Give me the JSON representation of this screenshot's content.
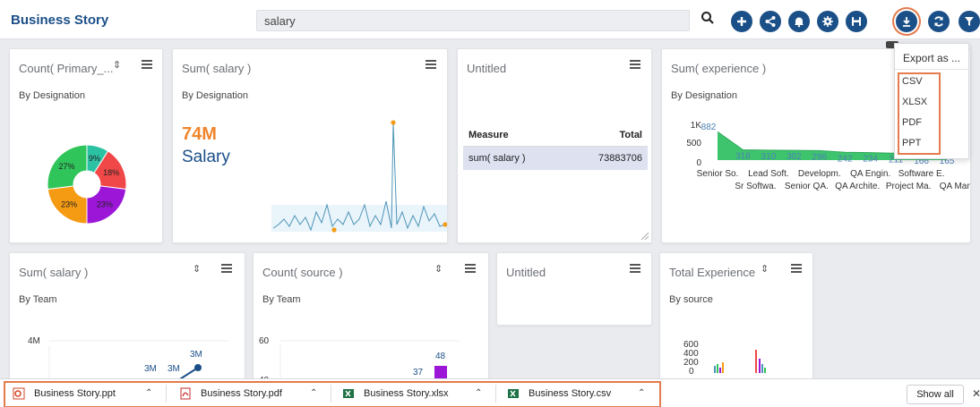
{
  "app": {
    "title": "Business Story"
  },
  "search": {
    "value": "salary"
  },
  "colors": {
    "brand": "#1b4f88",
    "accent": "#f0852d",
    "highlight": "#e37b4d"
  },
  "toolbar": {
    "icons": [
      "search-icon",
      "add-icon",
      "share-icon",
      "notification-icon",
      "settings-icon",
      "save-icon",
      "export-icon",
      "refresh-icon",
      "filter-icon"
    ]
  },
  "cards": {
    "count_primary": {
      "title": "Count( Primary_...",
      "subtitle": "By Designation",
      "chart_data": {
        "type": "pie",
        "labels": [
          "9%",
          "18%",
          "23%",
          "23%",
          "27%"
        ],
        "values": [
          9,
          18,
          23,
          23,
          27
        ],
        "colors": [
          "#2bc2a4",
          "#f04848",
          "#9b16d6",
          "#f59a13",
          "#2fc55a"
        ]
      }
    },
    "sum_salary_kpi": {
      "title": "Sum( salary )",
      "subtitle": "By Designation",
      "kpi_value": "74M",
      "kpi_label": "Salary"
    },
    "untitled_table": {
      "title": "Untitled",
      "col_measure": "Measure",
      "col_total": "Total",
      "row_measure": "sum( salary )",
      "row_total": "73883706"
    },
    "sum_experience": {
      "title": "Sum( experience )",
      "subtitle": "By Designation",
      "chart_data": {
        "type": "area",
        "categories": [
          "Senior So.",
          "Sr Softwa.",
          "Lead Soft.",
          "Senior QA.",
          "Developm.",
          "QA Archite.",
          "QA Engin.",
          "Project Ma.",
          "Software E.",
          "QA Mana."
        ],
        "values": [
          882,
          318,
          310,
          302,
          296,
          242,
          234,
          211,
          166,
          165
        ],
        "data_labels": [
          "882",
          "318",
          "310",
          "302",
          "296",
          "242",
          "234",
          "211",
          "166",
          "165"
        ],
        "y_ticks": [
          "1K",
          "500",
          "0"
        ],
        "ylim": [
          0,
          1000
        ]
      }
    },
    "sum_salary_team": {
      "title": "Sum( salary )",
      "subtitle": "By Team",
      "chart_data": {
        "type": "line",
        "y_ticks": [
          "4M"
        ],
        "data_labels": [
          "3M",
          "3M",
          "3M"
        ]
      }
    },
    "count_source": {
      "title": "Count( source )",
      "subtitle": "By Team",
      "chart_data": {
        "type": "bar",
        "y_ticks": [
          "60",
          "40"
        ],
        "data_labels": [
          "48",
          "37"
        ]
      }
    },
    "untitled2": {
      "title": "Untitled"
    },
    "total_experience": {
      "title": "Total Experience",
      "subtitle": "By source",
      "chart_data": {
        "type": "bar",
        "y_ticks": [
          "600",
          "400",
          "200",
          "0"
        ]
      }
    }
  },
  "export_menu": {
    "header": "Export as ...",
    "items": [
      "CSV",
      "XLSX",
      "PDF",
      "PPT"
    ]
  },
  "downloads": {
    "items": [
      {
        "name": "Business Story.ppt",
        "icon": "ppt-file-icon"
      },
      {
        "name": "Business Story.pdf",
        "icon": "pdf-file-icon"
      },
      {
        "name": "Business Story.xlsx",
        "icon": "excel-file-icon"
      },
      {
        "name": "Business Story.csv",
        "icon": "csv-file-icon"
      }
    ],
    "show_all": "Show all"
  }
}
